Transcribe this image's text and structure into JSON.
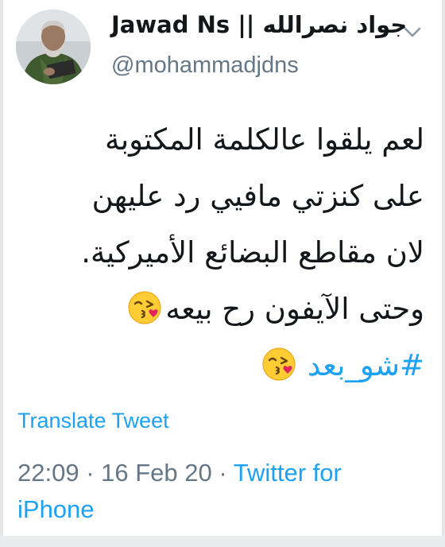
{
  "user": {
    "display_name": "Jawad Ns || جواد نصرالله",
    "handle": "@mohammadjdns",
    "avatar": "profile-photo"
  },
  "tweet": {
    "lines": [
      "لعم يلقوا عالكلمة المكتوبة",
      "على كنزتي مافيي رد عليهن",
      "لان مقاطع البضائع الأميركية.",
      "وحتى الآيفون رح بيعه"
    ],
    "hashtag": "#شو_بعد",
    "emoji": "face-blowing-a-kiss"
  },
  "actions": {
    "translate_label": "Translate Tweet",
    "chevron_icon": "chevron-down-icon"
  },
  "meta": {
    "time": "22:09",
    "separator": " · ",
    "date": "16 Feb 20",
    "source": "Twitter for iPhone"
  },
  "colors": {
    "link": "#1da1f2",
    "secondary": "#657786",
    "text": "#14171a"
  }
}
